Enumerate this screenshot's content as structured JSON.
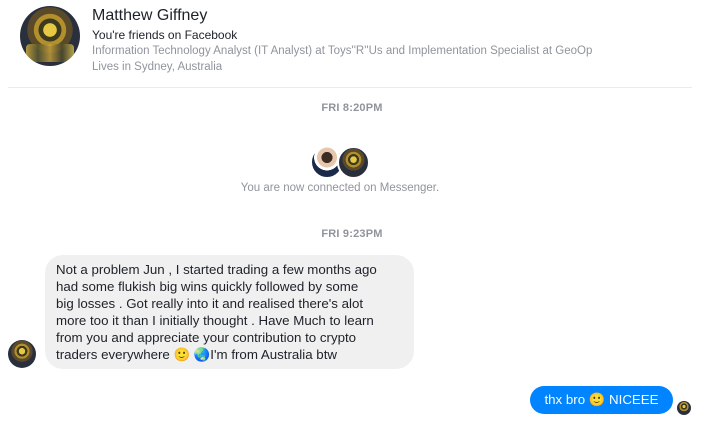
{
  "contact": {
    "name": "Matthew Giffney",
    "friend_status": "You're friends on Facebook",
    "work": "Information Technology Analyst (IT Analyst) at Toys''R''Us and Implementation Specialist at GeoOp",
    "location": "Lives in Sydney, Australia"
  },
  "thread": {
    "timestamp_1": "FRI 8:20PM",
    "connected_text": "You are now connected on Messenger.",
    "timestamp_2": "FRI 9:23PM",
    "incoming_message_lines": [
      "Not a problem Jun , I started trading a few months ago",
      "had some flukish big wins quickly followed by some",
      "big losses . Got really into it and realised there's alot",
      "more too it than I initially thought . Have Much to learn",
      "from you and appreciate your contribution to crypto",
      "traders everywhere 🙂 🌏I'm from Australia btw"
    ],
    "outgoing_message": "thx bro 🙂 NICEEE"
  },
  "colors": {
    "outgoing_bubble": "#0084ff",
    "incoming_bubble": "#f1f0f0",
    "muted_text": "#90949c"
  }
}
